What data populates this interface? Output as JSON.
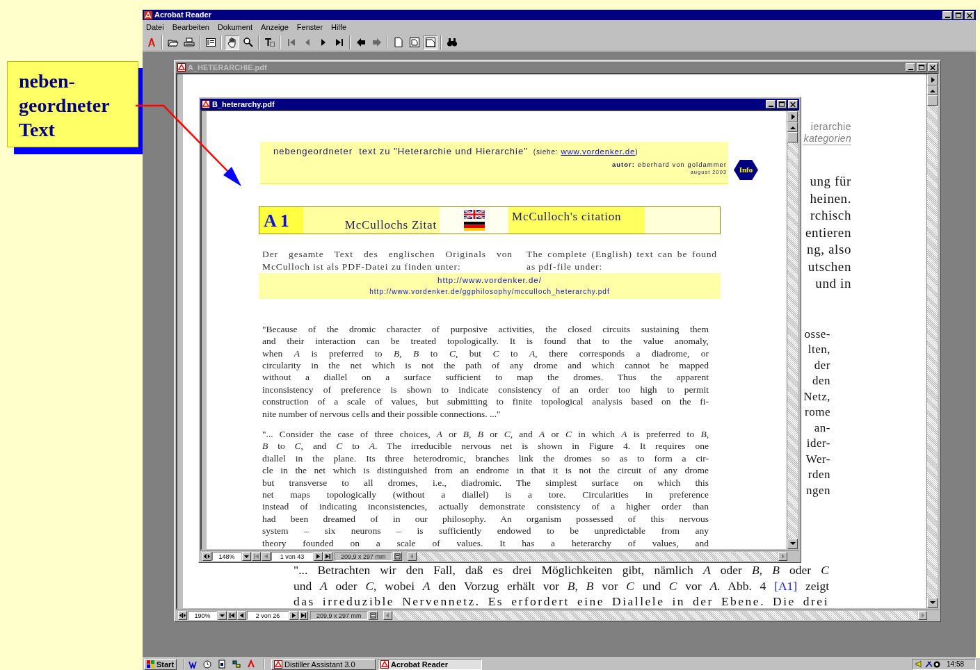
{
  "callout": {
    "lines": [
      "neben-",
      "geordneter",
      "Text"
    ]
  },
  "app_window": {
    "title": "Acrobat Reader",
    "menu": [
      "Datei",
      "Bearbeiten",
      "Dokument",
      "Anzeige",
      "Fenster",
      "Hilfe"
    ]
  },
  "toolbar": [
    {
      "kind": "logo",
      "pressed": false,
      "disabled": false
    },
    {
      "kind": "open",
      "pressed": false,
      "disabled": false
    },
    {
      "kind": "print",
      "pressed": false,
      "disabled": false
    },
    {
      "kind": "thumbnails",
      "pressed": false,
      "disabled": false
    },
    {
      "kind": "hand",
      "pressed": true,
      "disabled": false
    },
    {
      "kind": "zoom",
      "pressed": false,
      "disabled": false
    },
    {
      "kind": "textselect",
      "pressed": false,
      "disabled": false
    },
    {
      "kind": "first",
      "pressed": false,
      "disabled": true
    },
    {
      "kind": "prev",
      "pressed": false,
      "disabled": true
    },
    {
      "kind": "next",
      "pressed": false,
      "disabled": false
    },
    {
      "kind": "last",
      "pressed": false,
      "disabled": false
    },
    {
      "kind": "back",
      "pressed": false,
      "disabled": false
    },
    {
      "kind": "forward",
      "pressed": false,
      "disabled": true
    },
    {
      "kind": "actualsize",
      "pressed": false,
      "disabled": false
    },
    {
      "kind": "fitpage",
      "pressed": false,
      "disabled": false
    },
    {
      "kind": "fitwidth",
      "pressed": true,
      "disabled": false
    },
    {
      "kind": "find",
      "pressed": false,
      "disabled": false
    }
  ],
  "back_doc": {
    "title": "A_HETERARCHIE.pdf",
    "active": false,
    "header": [
      "ierarchie",
      "kategorien"
    ],
    "fragments_1": [
      "ung für",
      "heinen.",
      "rchisch",
      "entieren",
      "ng, also",
      "utschen",
      "und in"
    ],
    "fragments_2": [
      "osse-",
      "lten,",
      "der",
      "den",
      "Netz,",
      "rome",
      "an-",
      "ider-",
      "Wer-",
      "rden",
      "ngen"
    ],
    "paragraph": [
      "\"... Betrachten wir den Fall, daß es drei Möglichkeiten gibt, nämlich *A* oder *B*, *B* oder *C*",
      "und *A* oder *C*, wobei *A* den Vorzug erhält vor *B*, *B* vor *C* und *C* vor *A*. Abb. 4",
      "das irreduzible Nervennetz. Es erfordert eine Diallele in der Ebene. Die drei"
    ],
    "paragraph_link": "[A1]",
    "paragraph_link_tail": "zeigt",
    "status": {
      "zoom": "190%",
      "page": "2 von 26",
      "size": "209,9 x 297 mm",
      "first_disabled": false
    }
  },
  "front_doc": {
    "title": "B_heterarchy.pdf",
    "active": true,
    "banner": {
      "title": "nebengeordneter  text zu \"Heterarchie und Hierarchie\"",
      "see": "(siehe:",
      "link": "www.vordenker.de",
      "see_end": ")",
      "author_label": "autor:",
      "author": "eberhard von goldammer",
      "date": "august 2003"
    },
    "info_badge": "Info",
    "section": {
      "number": "A 1",
      "german_title": "McCullochs Zitat",
      "english_title": "McCulloch's citation"
    },
    "intro_de": "Der gesamte Text des englischen Originals von McCulloch ist als PDF-Datei zu finden unter:",
    "intro_en": "The complete (English) text can be found as pdf-file under:",
    "links": [
      "http://www.vordenker.de/",
      "http://www.vordenker.de/ggphilosophy/mcculloch_heterarchy.pdf"
    ],
    "quote_1": [
      "\"Because of the dromic character of purposive activities, the closed circuits sustaining them",
      "and their interaction can be treated topologically. It is found that to the value anomaly,",
      "when *A* is preferred to *B*, *B* to *C*, but *C* to *A*, there corresponds a diadrome, or",
      "circularity in the net which is not the path of any drome and which cannot be mapped",
      "without a diallel on a surface sufficient to map the dromes. Thus the apparent",
      "inconsistency of preference is shown to indicate consistency of an order too high to permit",
      "construction of a scale of values, but submitting to finite topological analysis based on the fi-",
      "nite number of nervous cells and their possible connections. ...\""
    ],
    "quote_2": [
      "\"... Consider the case of three choices, *A* or *B*, *B* or *C*, and *A* or *C* in which *A* is preferred to *B*,",
      "*B* to *C*, and *C* to *A*. The irreducible nervous net is shown in Figure 4. It requires one",
      "diallel in the plane. Its three heterodromic, branches link the dromes so as to form a cir-",
      "cle in the net which is distinguished from an endrome in that it is not the circuit of any drome",
      "but transverse to all dromes, i.e., diadromic. The simplest surface on which this",
      "net maps topologically (without a diallel) is a tore. Circularities in preference",
      "instead of indicating inconsistencies, actually demonstrate consistency of a higher order than",
      "had been dreamed of in our philosophy. An organism possessed of this nervous",
      "system – six neurons – is sufficiently endowed to be unpredictable from any",
      "theory founded on a scale of values. It has a heterarchy of values, and"
    ],
    "status": {
      "zoom": "148%",
      "page": "1 von 43",
      "size": "209,9 x 297 mm",
      "first_disabled": true
    }
  },
  "taskbar": {
    "start": "Start",
    "tasks": [
      {
        "label": "Distiller Assistant 3.0",
        "selected": false
      },
      {
        "label": "Acrobat Reader",
        "selected": true
      }
    ],
    "clock": "14:58"
  }
}
